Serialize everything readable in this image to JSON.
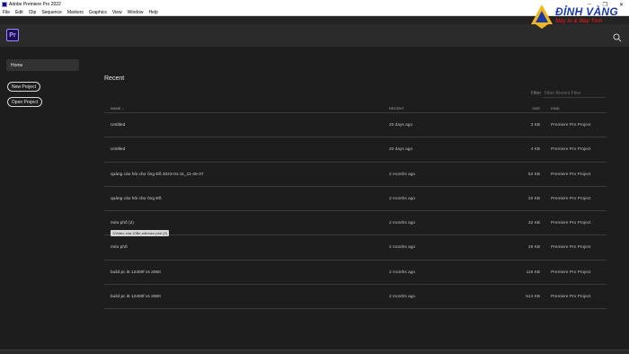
{
  "window": {
    "title": "Adobe Premiere Pro 2022",
    "controls": {
      "minimize": "–",
      "maximize": "❐",
      "close": "✕"
    }
  },
  "menu": [
    "File",
    "Edit",
    "Clip",
    "Sequence",
    "Markers",
    "Graphics",
    "View",
    "Window",
    "Help"
  ],
  "header": {
    "logo_text": "Pr"
  },
  "watermark": {
    "brand": "ĐỈNH VÀNG",
    "slogan": "Máy In & Máy Tính"
  },
  "sidebar": {
    "home": "Home",
    "new_project": "New Project",
    "open_project": "Open Project"
  },
  "main": {
    "title": "Recent",
    "filter_label": "Filter",
    "filter_placeholder": "Filter Recent Files",
    "columns": {
      "name": "NAME ↓",
      "recent": "RECENT",
      "size": "SIZE",
      "kind": "KIND"
    },
    "rows": [
      {
        "name": "Untitled",
        "recent": "20 days ago",
        "size": "3 KB",
        "kind": "Premiere Pro Project"
      },
      {
        "name": "Untitled",
        "recent": "20 days ago",
        "size": "4 KB",
        "kind": "Premiere Pro Project"
      },
      {
        "name": "quảng cáo hỏi chợ ông Đồ 2023-01-11_11-40-37",
        "recent": "2 months ago",
        "size": "52 KB",
        "kind": "Premiere Pro Project"
      },
      {
        "name": "quảng cáo hỏi chợ ông Đồ",
        "recent": "2 months ago",
        "size": "20 KB",
        "kind": "Premiere Pro Project"
      },
      {
        "name": "mèo phố (2)",
        "recent": "2 months ago",
        "size": "32 KB",
        "kind": "Premiere Pro Project"
      },
      {
        "name": "mèo phố",
        "recent": "2 months ago",
        "size": "29 KB",
        "kind": "Premiere Pro Project"
      },
      {
        "name": "build pc i5 12400f vs 2060",
        "recent": "2 months ago",
        "size": "116 KB",
        "kind": "Premiere Pro Project"
      },
      {
        "name": "build pc i5 12400f vs 2060",
        "recent": "2 months ago",
        "size": "514 KB",
        "kind": "Premiere Pro Project"
      }
    ],
    "tooltip": "1/Video của 10Be-edhmeo phố (2)"
  },
  "colors": {
    "background": "#1d1d1d",
    "header": "#2b2b2b",
    "pr_logo_bg": "#1c0f55",
    "pr_logo_fg": "#b7a7ff"
  }
}
